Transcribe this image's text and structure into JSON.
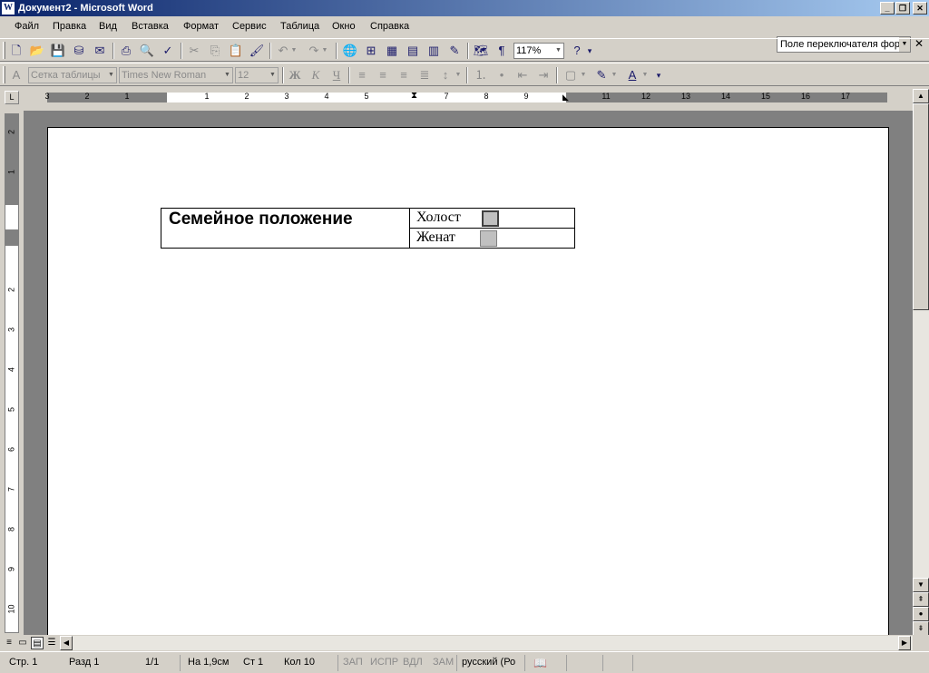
{
  "title": "Документ2 - Microsoft Word",
  "menu": [
    "Файл",
    "Правка",
    "Вид",
    "Вставка",
    "Формат",
    "Сервис",
    "Таблица",
    "Окно",
    "Справка"
  ],
  "help_box": "Поле переключателя фор",
  "toolbar": {
    "zoom": "117%"
  },
  "formatting": {
    "style": "Сетка таблицы",
    "font": "Times New Roman",
    "size": "12",
    "bold": "Ж",
    "italic": "К",
    "underline": "Ч"
  },
  "document": {
    "label": "Семейное положение",
    "option1": "Холост",
    "option2": "Женат"
  },
  "status": {
    "page": "Стр. 1",
    "section": "Разд 1",
    "pages": "1/1",
    "at": "На 1,9см",
    "line": "Ст 1",
    "col": "Кол 10",
    "rec": "ЗАП",
    "trk": "ИСПР",
    "ext": "ВДЛ",
    "ovr": "ЗАМ",
    "lang": "русский (Ро"
  }
}
